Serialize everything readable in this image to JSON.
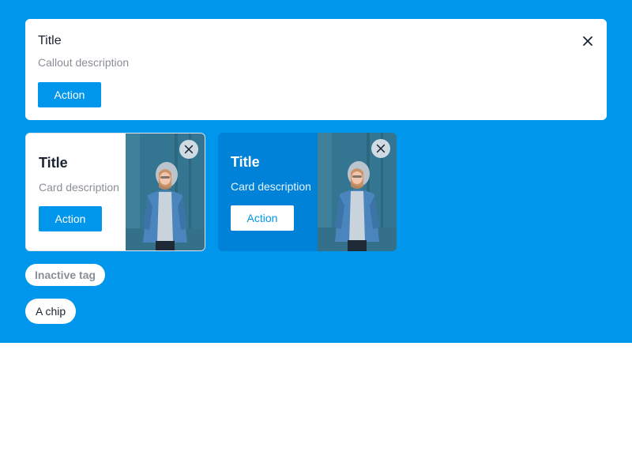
{
  "colors": {
    "canvas": "#0096eb",
    "primary_button": "#0096eb",
    "dark_card": "#0082d8",
    "title_text": "#1b2330",
    "muted_text": "#8a8f96"
  },
  "callout": {
    "title": "Title",
    "description": "Callout description",
    "action_label": "Action",
    "close_icon": "close-icon"
  },
  "cards": [
    {
      "variant": "light",
      "title": "Title",
      "description": "Card description",
      "action_label": "Action",
      "close_icon": "close-icon"
    },
    {
      "variant": "dark",
      "title": "Title",
      "description": "Card description",
      "action_label": "Action",
      "close_icon": "close-icon"
    }
  ],
  "tag": {
    "label": "Inactive tag"
  },
  "chip": {
    "label": "A chip"
  }
}
